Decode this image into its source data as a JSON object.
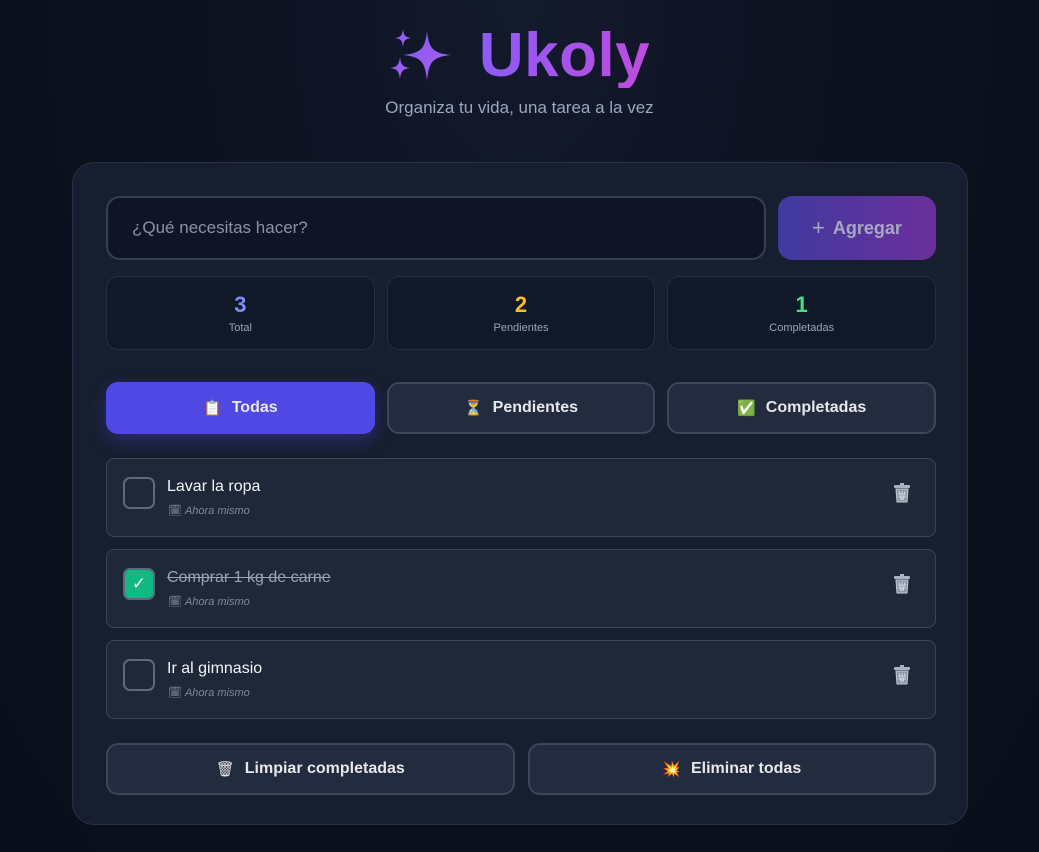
{
  "app": {
    "title": "Ukoly",
    "subtitle": "Organiza tu vida, una tarea a la vez",
    "logo_icon": "sparkles-icon"
  },
  "add_task": {
    "placeholder": "¿Qué necesitas hacer?",
    "value": "",
    "button_plus": "+",
    "button_label": "Agregar"
  },
  "stats": [
    {
      "value": "3",
      "label": "Total",
      "color": "#818cf8"
    },
    {
      "value": "2",
      "label": "Pendientes",
      "color": "#fbbf24"
    },
    {
      "value": "1",
      "label": "Completadas",
      "color": "#4ade80"
    }
  ],
  "filters": [
    {
      "icon": "📋",
      "icon_name": "clipboard-icon",
      "label": "Todas",
      "active": true
    },
    {
      "icon": "⏳",
      "icon_name": "hourglass-icon",
      "label": "Pendientes",
      "active": false
    },
    {
      "icon": "✅",
      "icon_name": "check-box-icon",
      "label": "Completadas",
      "active": false
    }
  ],
  "tasks": [
    {
      "text": "Lavar la ropa",
      "meta_icon": "🗓",
      "meta": "Ahora mismo",
      "completed": false,
      "check_mark": ""
    },
    {
      "text": "Comprar 1 kg de carne",
      "meta_icon": "🗓",
      "meta": "Ahora mismo",
      "completed": true,
      "check_mark": "✓"
    },
    {
      "text": "Ir al gimnasio",
      "meta_icon": "🗓",
      "meta": "Ahora mismo",
      "completed": false,
      "check_mark": ""
    }
  ],
  "actions": {
    "clear_completed": {
      "icon": "🗑",
      "icon_name": "trash-icon",
      "label": "Limpiar completadas"
    },
    "delete_all": {
      "icon": "💥",
      "icon_name": "explosion-icon",
      "label": "Eliminar todas"
    }
  },
  "colors": {
    "accent": "#5048e5",
    "brand_gradient_start": "#8b5cf6",
    "brand_gradient_end": "#c04bdf",
    "checked": "#10b981"
  }
}
